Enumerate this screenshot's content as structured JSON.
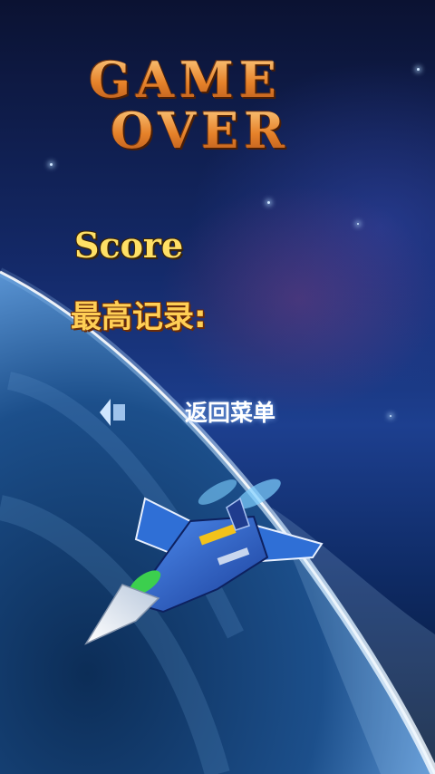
{
  "title": {
    "line1": "GAME",
    "line2": "OVER"
  },
  "score": {
    "label": "Score"
  },
  "best_record": {
    "label": "最高记录:"
  },
  "menu": {
    "back_label": "返回菜单"
  },
  "icons": {
    "back": "left-arrow-icon"
  },
  "colors": {
    "title": "#e6822a",
    "score": "#ffe066",
    "best_record": "#ffcf55",
    "button_text": "#ffffff"
  }
}
